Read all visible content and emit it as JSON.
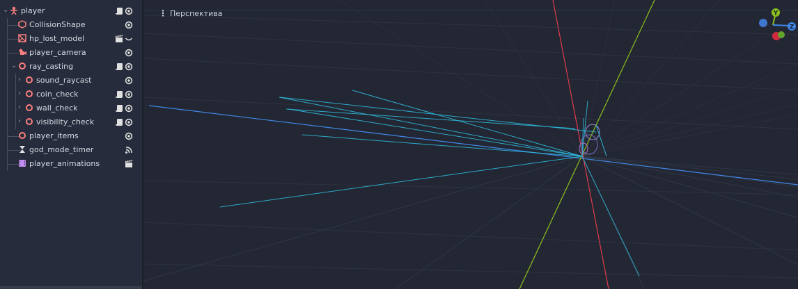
{
  "scene_tree": {
    "nodes": [
      {
        "label": "player",
        "depth": 0,
        "arrow": "⌄",
        "icon": "player-icon",
        "actions": [
          "script-icon",
          "eye-icon"
        ]
      },
      {
        "label": "CollisionShape",
        "depth": 1,
        "arrow": "",
        "icon": "collision-shape-icon",
        "actions": [
          "eye-icon"
        ]
      },
      {
        "label": "hp_lost_model",
        "depth": 1,
        "arrow": "",
        "icon": "mesh-model-icon",
        "actions": [
          "film-icon",
          "eye-closed-icon"
        ]
      },
      {
        "label": "player_camera",
        "depth": 1,
        "arrow": "",
        "icon": "camera-icon",
        "actions": [
          "eye-icon"
        ]
      },
      {
        "label": "ray_casting",
        "depth": 1,
        "arrow": "⌄",
        "icon": "node3d-icon",
        "actions": [
          "script-icon",
          "eye-icon"
        ]
      },
      {
        "label": "sound_raycast",
        "depth": 2,
        "arrow": "›",
        "icon": "node3d-icon",
        "actions": [
          "eye-icon"
        ]
      },
      {
        "label": "coin_check",
        "depth": 2,
        "arrow": "›",
        "icon": "node3d-icon",
        "actions": [
          "script-icon",
          "eye-icon"
        ]
      },
      {
        "label": "wall_check",
        "depth": 2,
        "arrow": "›",
        "icon": "node3d-icon",
        "actions": [
          "script-icon",
          "eye-icon"
        ]
      },
      {
        "label": "visibility_check",
        "depth": 2,
        "arrow": "›",
        "icon": "node3d-icon",
        "actions": [
          "script-icon",
          "eye-icon"
        ]
      },
      {
        "label": "player_items",
        "depth": 1,
        "arrow": "",
        "icon": "node3d-icon",
        "actions": [
          "eye-icon"
        ]
      },
      {
        "label": "god_mode_timer",
        "depth": 1,
        "arrow": "",
        "icon": "timer-icon",
        "actions": [
          "signal-icon"
        ]
      },
      {
        "label": "player_animations",
        "depth": 1,
        "arrow": "",
        "icon": "animation-player-icon",
        "actions": [
          "film-icon"
        ]
      }
    ]
  },
  "viewport": {
    "menu_label": "Перспектива",
    "menu_icon": "kebab-menu-icon",
    "gizmo": {
      "y_label": "Y",
      "z_label": "Z"
    }
  },
  "colors": {
    "panel_bg": "#262c3b",
    "viewport_bg": "#232733",
    "node3d_red": "#fc7f7f",
    "script_white": "#e0e0e0",
    "raycast_cyan": "#2fb7d8",
    "x_axis": "#e23a4d",
    "y_axis": "#8cc21d",
    "z_axis": "#3f88e8"
  }
}
